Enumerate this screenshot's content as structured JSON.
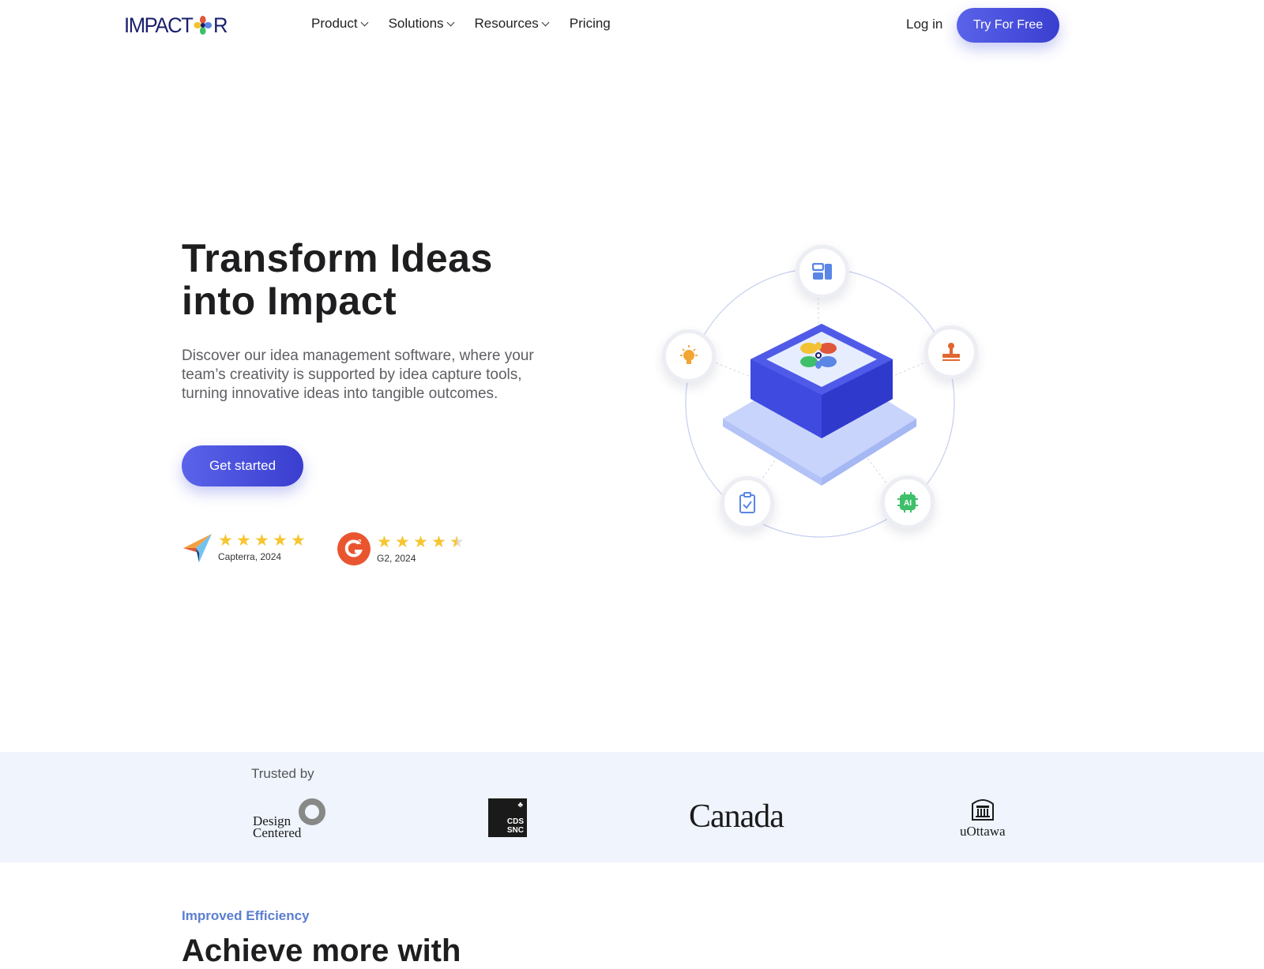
{
  "header": {
    "logo_text_left": "IMPACT",
    "logo_text_right": "R",
    "nav": [
      {
        "label": "Product",
        "has_dropdown": true
      },
      {
        "label": "Solutions",
        "has_dropdown": true
      },
      {
        "label": "Resources",
        "has_dropdown": true
      },
      {
        "label": "Pricing",
        "has_dropdown": false
      }
    ],
    "login_label": "Log in",
    "cta_label": "Try For Free"
  },
  "hero": {
    "title_line1": "Transform Ideas",
    "title_line2": "into Impact",
    "subtitle": "Discover our idea management software, where your team’s creativity is supported by idea capture tools, turning innovative ideas into tangible outcomes.",
    "cta_label": "Get started",
    "ratings": [
      {
        "source": "Capterra",
        "label": "Capterra, 2024",
        "stars": 5
      },
      {
        "source": "G2",
        "label": "G2, 2024",
        "stars": 4.5
      }
    ]
  },
  "illustration": {
    "nodes": [
      {
        "name": "dashboard-icon",
        "color": "#5b86e5"
      },
      {
        "name": "lightbulb-icon",
        "color": "#f2a533"
      },
      {
        "name": "stamp-icon",
        "color": "#e0672f"
      },
      {
        "name": "clipboard-check-icon",
        "color": "#5b86e5"
      },
      {
        "name": "ai-chip-icon",
        "color": "#3fbf6a",
        "text": "AI"
      }
    ]
  },
  "trusted": {
    "label": "Trusted by",
    "logos": [
      {
        "name": "Design Centered",
        "line1": "Design",
        "line2": "Centered"
      },
      {
        "name": "CDS SNC",
        "line1": "CDS",
        "line2": "SNC"
      },
      {
        "name": "Canada",
        "text": "Canada"
      },
      {
        "name": "uOttawa",
        "text": "uOttawa"
      }
    ]
  },
  "section": {
    "eyebrow": "Improved Efficiency",
    "title": "Achieve more with"
  },
  "colors": {
    "brand": "#4a50dd",
    "star": "#f7c531",
    "eyebrow": "#5b7ed0"
  }
}
